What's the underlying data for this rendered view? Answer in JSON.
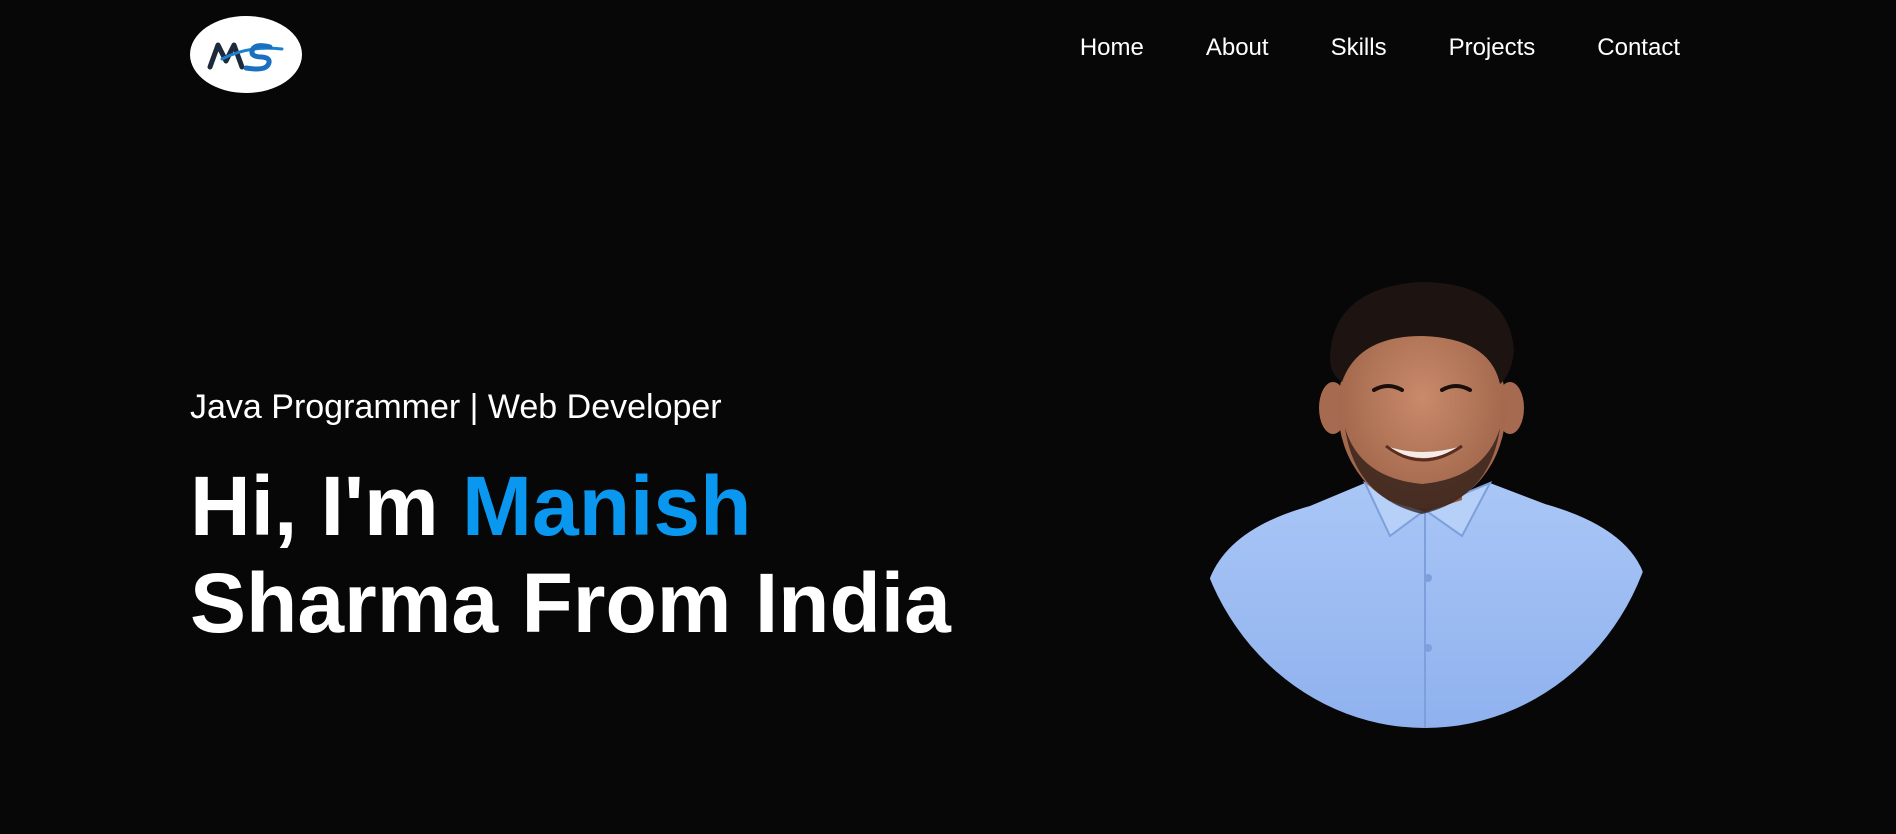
{
  "header": {
    "logo_text": "MS",
    "nav": [
      {
        "label": "Home"
      },
      {
        "label": "About"
      },
      {
        "label": "Skills"
      },
      {
        "label": "Projects"
      },
      {
        "label": "Contact"
      }
    ]
  },
  "hero": {
    "subtitle": "Java Programmer | Web Developer",
    "greeting": "Hi, I'm",
    "first_name": "Manish",
    "rest": "Sharma From India"
  },
  "colors": {
    "background": "#070707",
    "accent": "#0a97ef",
    "text": "#ffffff"
  },
  "portrait": {
    "icon": "person-photo"
  }
}
